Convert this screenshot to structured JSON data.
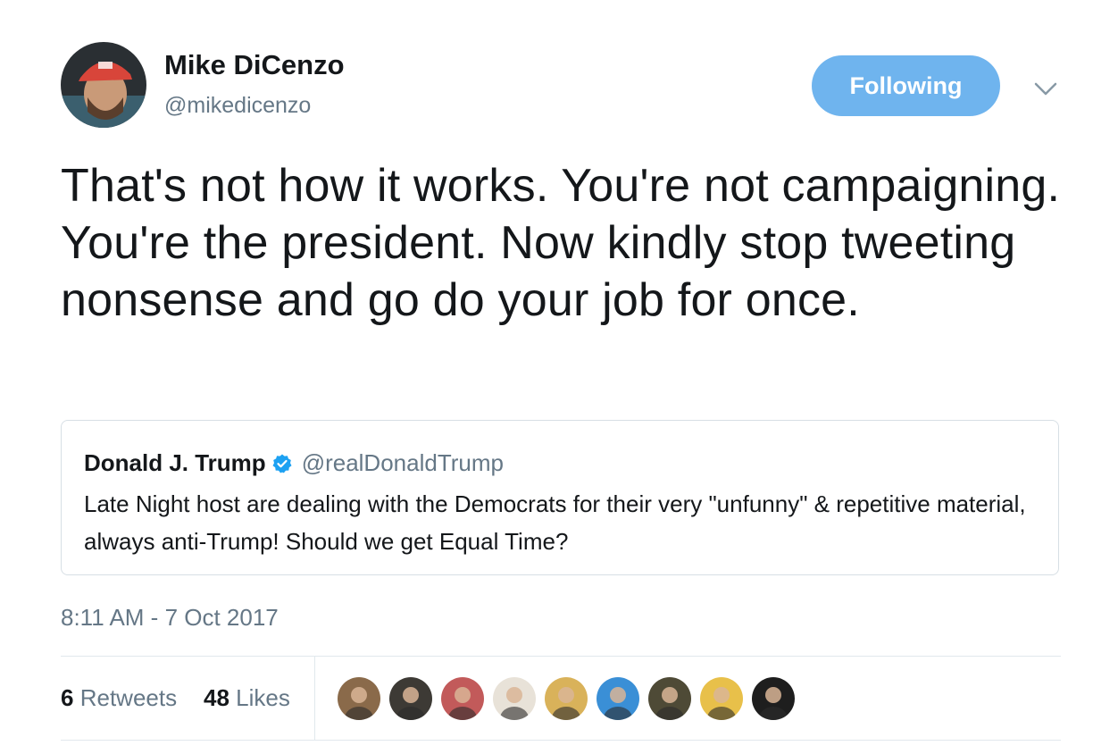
{
  "author": {
    "name": "Mike DiCenzo",
    "handle": "@mikedicenzo",
    "avatar_icon": "user-avatar-red-cap"
  },
  "follow_button": {
    "label": "Following",
    "color": "#6fb4ee"
  },
  "menu_icon": "chevron-down-icon",
  "tweet": {
    "text": "That's not how it works. You're not campaigning. You're the president. Now kindly stop tweeting nonsense and go do your job for once."
  },
  "quoted_tweet": {
    "name": "Donald J. Trump",
    "verified_icon": "verified-badge-icon",
    "handle": "@realDonaldTrump",
    "text": "Late Night host are dealing with the Democrats for their very \"unfunny\" & repetitive material, always anti-Trump! Should we get Equal Time?"
  },
  "timestamp": "8:11 AM - 7 Oct 2017",
  "stats": {
    "retweets_count": "6",
    "retweets_label": "Retweets",
    "likes_count": "48",
    "likes_label": "Likes"
  },
  "liker_avatars": [
    {
      "icon": "avatar-icon",
      "color": "#8a6a4a"
    },
    {
      "icon": "avatar-icon",
      "color": "#3d3a35"
    },
    {
      "icon": "avatar-icon",
      "color": "#c25a5a"
    },
    {
      "icon": "avatar-icon",
      "color": "#e8e2d8"
    },
    {
      "icon": "avatar-icon",
      "color": "#d9b25a"
    },
    {
      "icon": "avatar-icon",
      "color": "#3a8fd6"
    },
    {
      "icon": "avatar-icon",
      "color": "#4e4a36"
    },
    {
      "icon": "avatar-icon",
      "color": "#e8c04a"
    },
    {
      "icon": "avatar-icon",
      "color": "#1e1e1e"
    }
  ]
}
